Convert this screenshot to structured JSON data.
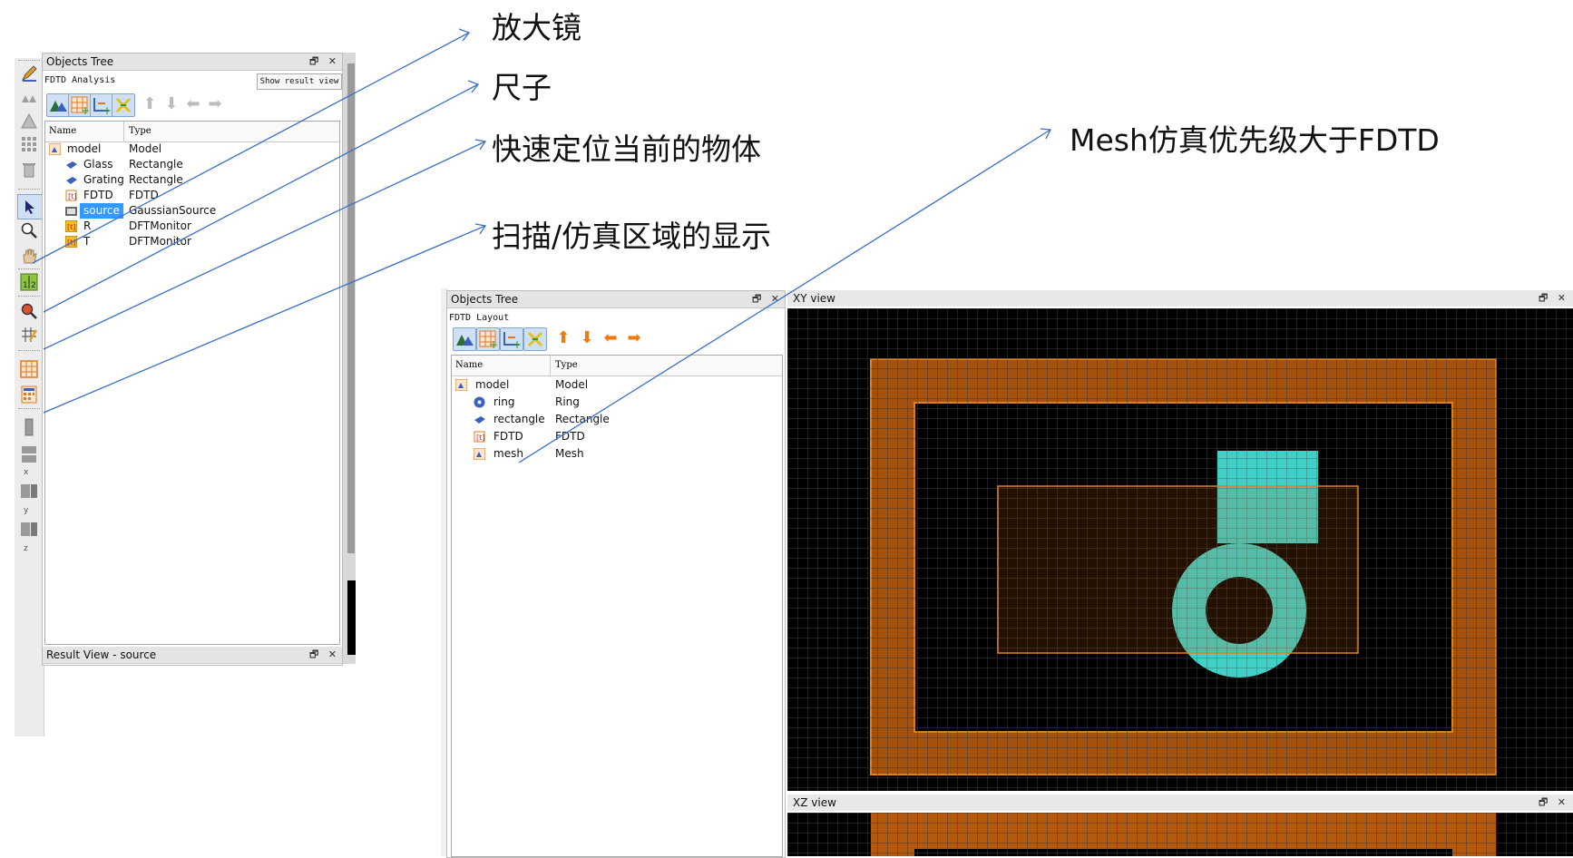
{
  "annotations": {
    "magnifier": "放大镜",
    "ruler": "尺子",
    "locate": "快速定位当前的物体",
    "mesh_priority": "Mesh仿真优先级大于FDTD",
    "scan_region": "扫描/仿真区域的显示"
  },
  "left_panel": {
    "title": "Objects Tree",
    "subtitle": "FDTD Analysis",
    "show_result_button": "Show result view",
    "columns": {
      "name": "Name",
      "type": "Type"
    },
    "rows": [
      {
        "name": "model",
        "type": "Model"
      },
      {
        "name": "Glass",
        "type": "Rectangle"
      },
      {
        "name": "Grating",
        "type": "Rectangle"
      },
      {
        "name": "FDTD",
        "type": "FDTD"
      },
      {
        "name": "source",
        "type": "GaussianSource"
      },
      {
        "name": "R",
        "type": "DFTMonitor"
      },
      {
        "name": "T",
        "type": "DFTMonitor"
      }
    ],
    "result_view_title": "Result View - source",
    "toolbar_axis_labels": [
      "x",
      "y",
      "z"
    ]
  },
  "right_panel": {
    "title": "Objects Tree",
    "subtitle": "FDTD Layout",
    "columns": {
      "name": "Name",
      "type": "Type"
    },
    "rows": [
      {
        "name": "model",
        "type": "Model"
      },
      {
        "name": "ring",
        "type": "Ring"
      },
      {
        "name": "rectangle",
        "type": "Rectangle"
      },
      {
        "name": "FDTD",
        "type": "FDTD"
      },
      {
        "name": "mesh",
        "type": "Mesh"
      }
    ]
  },
  "views": {
    "xy_title": "XY view",
    "xz_title": "XZ view"
  },
  "window_buttons": {
    "float": "🗗",
    "close": "✕"
  },
  "colors": {
    "view_background": "#000000",
    "grid": "#3a3a3a",
    "orange": "#c26410",
    "cyan": "#40d0c8",
    "selection": "#3399ff",
    "annotation_line": "#3c6fc4"
  }
}
